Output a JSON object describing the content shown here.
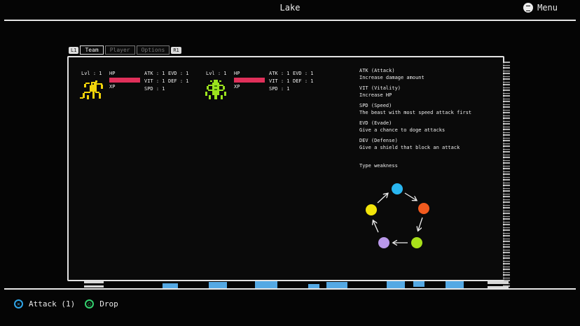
{
  "header": {
    "title": "Lake",
    "menu_label": "Menu"
  },
  "tabs": {
    "left_bumper": "L1",
    "right_bumper": "R1",
    "items": [
      {
        "label": "Team",
        "active": true
      },
      {
        "label": "Player",
        "active": false
      },
      {
        "label": "Options",
        "active": false
      }
    ]
  },
  "beasts": [
    {
      "level": "Lvl : 1",
      "hp_label": "HP",
      "xp_label": "XP",
      "hp_fraction": 1.0,
      "atk": "ATK : 1",
      "evd": "EVD : 1",
      "vit": "VIT : 1",
      "def": "DEF : 1",
      "spd": "SPD : 1",
      "color": "#f2d40a"
    },
    {
      "level": "Lvl : 1",
      "hp_label": "HP",
      "xp_label": "XP",
      "hp_fraction": 1.0,
      "atk": "ATK : 1",
      "evd": "EVD : 1",
      "vit": "VIT : 1",
      "def": "DEF : 1",
      "spd": "SPD : 1",
      "color": "#9be21d"
    }
  ],
  "info": [
    {
      "title": "ATK (Attack)",
      "desc": "Increase damage amount"
    },
    {
      "title": "VIT (Vitality)",
      "desc": "Increase HP"
    },
    {
      "title": "SPD  (Speed)",
      "desc": "The beast with most speed attack first"
    },
    {
      "title": "EVD  (Evade)",
      "desc": "Give a chance to doge attacks"
    },
    {
      "title": "DEV  (Defense)",
      "desc": "Give a shield that block an attack"
    }
  ],
  "type_weakness": {
    "label": "Type weakness",
    "colors": [
      "#29b6f0",
      "#f15a1e",
      "#a8e01a",
      "#b998ea",
      "#f2e40a"
    ]
  },
  "footer": {
    "attack_label": "Attack (1)",
    "drop_label": "Drop",
    "attack_icon_color": "#2fa4e6",
    "drop_icon_color": "#33d06e"
  }
}
